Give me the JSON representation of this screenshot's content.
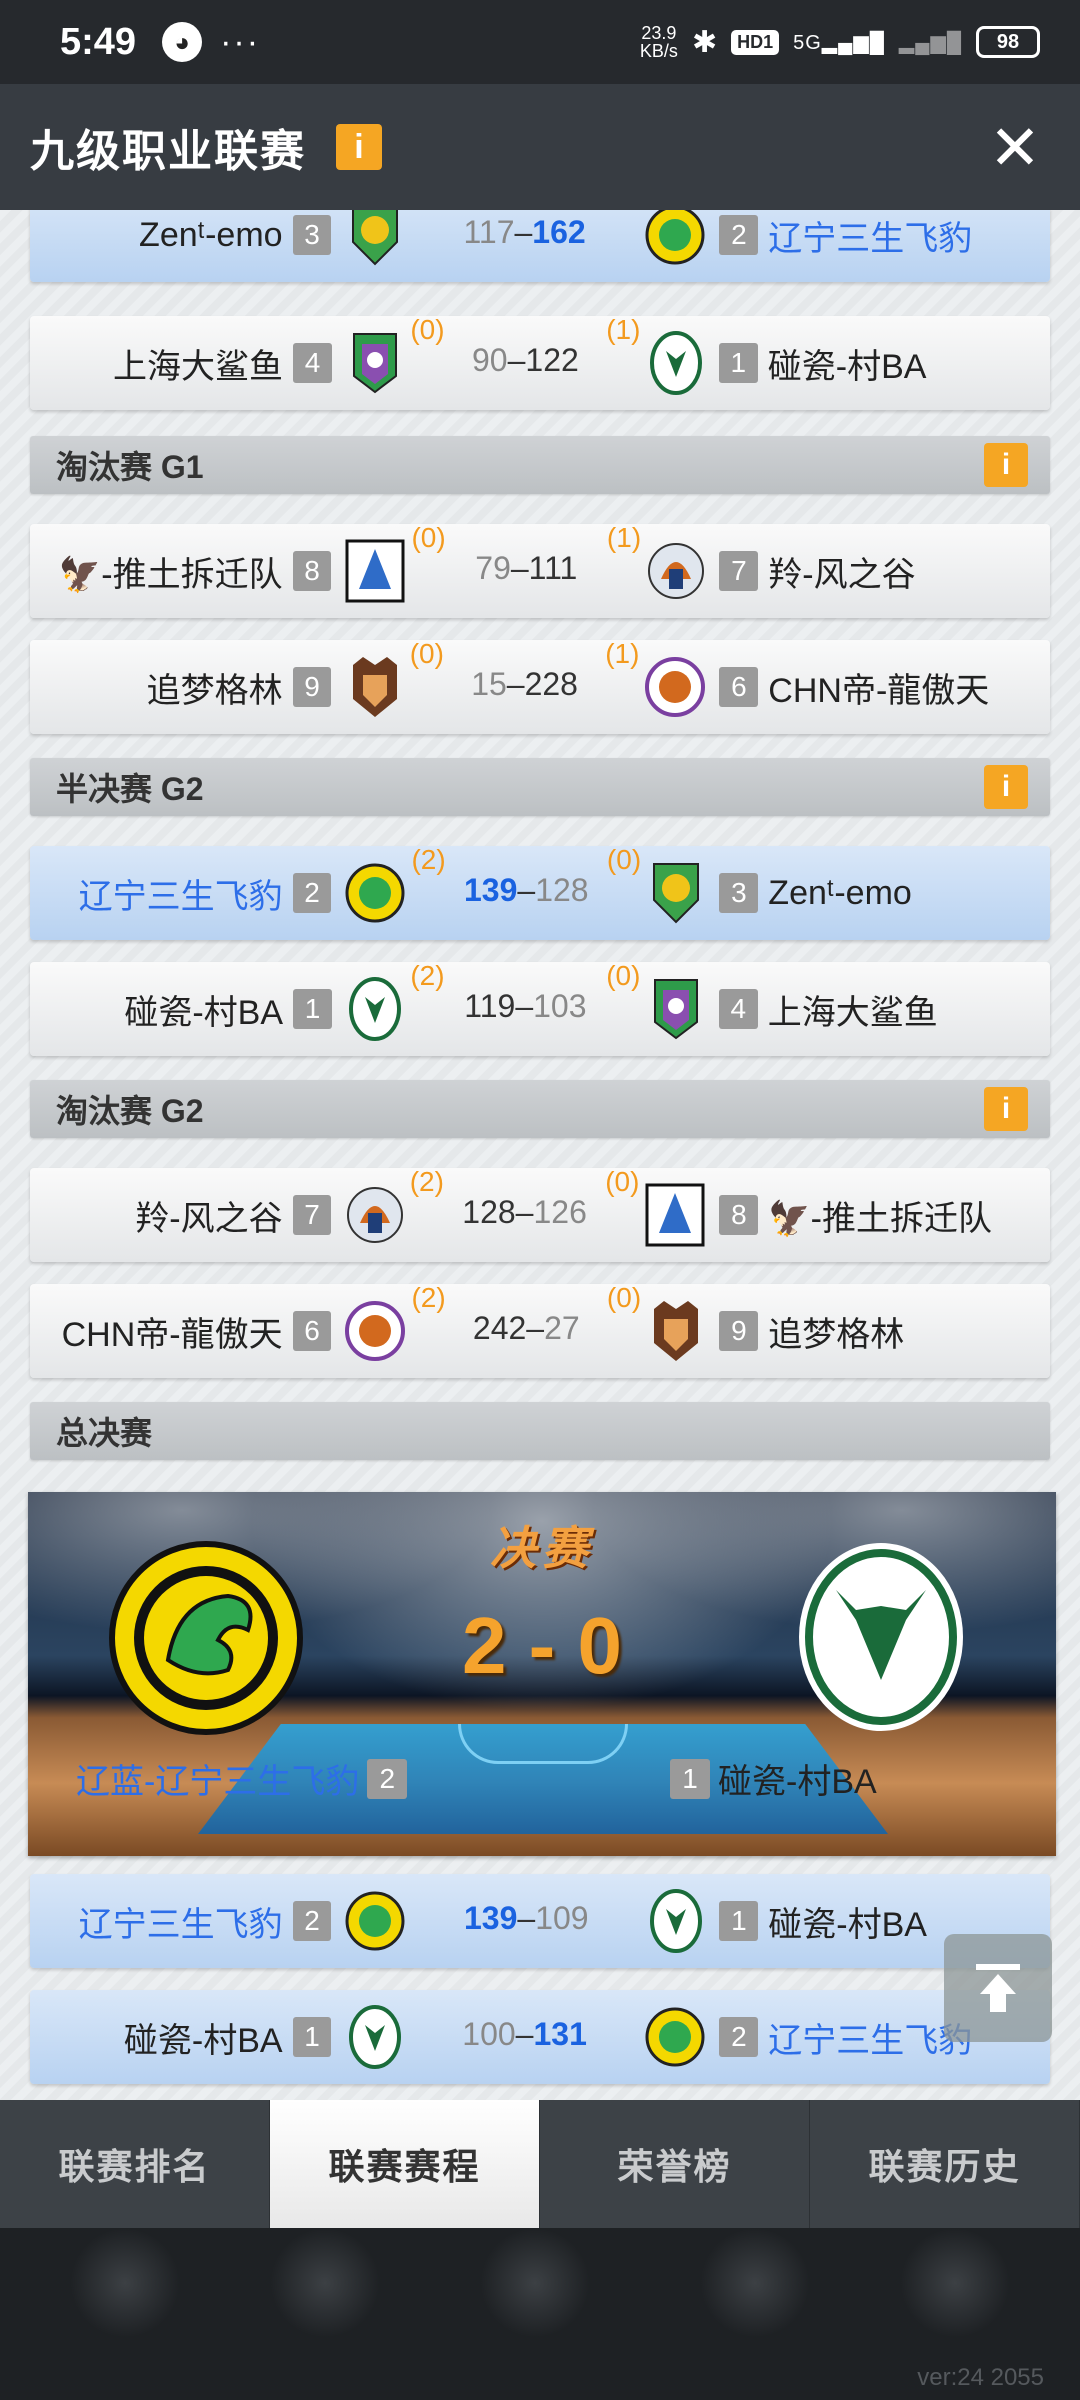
{
  "status_bar": {
    "time": "5:49",
    "dots": "···",
    "net_speed_value": "23.9",
    "net_speed_unit": "KB/s",
    "hd": "HD1",
    "signal": "5G",
    "battery": "98"
  },
  "header": {
    "title": "九级职业联赛",
    "info": "i",
    "close": "✕"
  },
  "rounds": {
    "r1": {
      "m1": {
        "left": "Zenᵗ-emo",
        "left_seed": "3",
        "left_score": "117",
        "right_score": "162",
        "right": "辽宁三生飞豹",
        "right_seed": "2"
      },
      "m2": {
        "left": "上海大鲨鱼",
        "left_seed": "4",
        "left_wins": "(0)",
        "left_score": "90",
        "right_score": "122",
        "right_wins": "(1)",
        "right": "碰瓷-村BA",
        "right_seed": "1"
      }
    },
    "elim_g1": {
      "title": "淘汰赛 G1",
      "m1": {
        "left": "-推土拆迁队",
        "left_seed": "8",
        "left_wins": "(0)",
        "left_score": "79",
        "right_score": "111",
        "right_wins": "(1)",
        "right": "羚-风之谷",
        "right_seed": "7"
      },
      "m2": {
        "left": "追梦格林",
        "left_seed": "9",
        "left_wins": "(0)",
        "left_score": "15",
        "right_score": "228",
        "right_wins": "(1)",
        "right": "CHN帝-龍傲天",
        "right_seed": "6"
      }
    },
    "semi_g2": {
      "title": "半决赛 G2",
      "m1": {
        "left": "辽宁三生飞豹",
        "left_seed": "2",
        "left_wins": "(2)",
        "left_score": "139",
        "right_score": "128",
        "right_wins": "(0)",
        "right": "Zenᵗ-emo",
        "right_seed": "3"
      },
      "m2": {
        "left": "碰瓷-村BA",
        "left_seed": "1",
        "left_wins": "(2)",
        "left_score": "119",
        "right_score": "103",
        "right_wins": "(0)",
        "right": "上海大鲨鱼",
        "right_seed": "4"
      }
    },
    "elim_g2": {
      "title": "淘汰赛 G2",
      "m1": {
        "left": "羚-风之谷",
        "left_seed": "7",
        "left_wins": "(2)",
        "left_score": "128",
        "right_score": "126",
        "right_wins": "(0)",
        "right": "-推土拆迁队",
        "right_seed": "8"
      },
      "m2": {
        "left": "CHN帝-龍傲天",
        "left_seed": "6",
        "left_wins": "(2)",
        "left_score": "242",
        "right_score": "27",
        "right_wins": "(0)",
        "right": "追梦格林",
        "right_seed": "9"
      }
    },
    "finals": {
      "title": "总决赛",
      "banner": {
        "headline": "决赛",
        "score": "2 - 0",
        "left": "辽蓝-辽宁三生飞豹",
        "left_seed": "2",
        "right": "碰瓷-村BA",
        "right_seed": "1"
      },
      "m1": {
        "left": "辽宁三生飞豹",
        "left_seed": "2",
        "left_score": "139",
        "right_score": "109",
        "right": "碰瓷-村BA",
        "right_seed": "1"
      },
      "m2": {
        "left": "碰瓷-村BA",
        "left_seed": "1",
        "left_score": "100",
        "right_score": "131",
        "right": "辽宁三生飞豹",
        "right_seed": "2"
      }
    }
  },
  "tabs": [
    {
      "label": "联赛排名"
    },
    {
      "label": "联赛赛程"
    },
    {
      "label": "荣誉榜"
    },
    {
      "label": "联赛历史"
    }
  ],
  "version": "ver:24  2055",
  "colors": {
    "winner_score": "#1a62e0",
    "series_wins": "#f39a1e",
    "info_badge": "#f5a623",
    "highlight_row": "#c6dcf5"
  }
}
